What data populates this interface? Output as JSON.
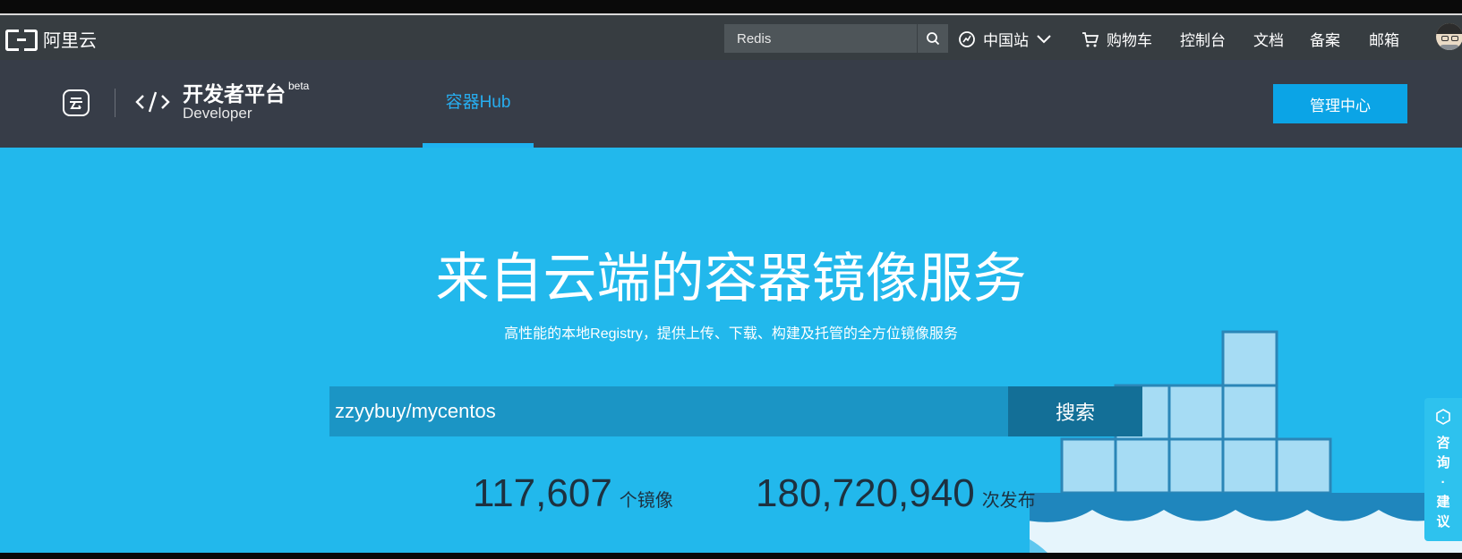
{
  "topbar": {
    "brand": "阿里云",
    "search_value": "Redis",
    "region": "中国站",
    "cart": "购物车",
    "console": "控制台",
    "docs": "文档",
    "beian": "备案",
    "mail": "邮箱"
  },
  "devbar": {
    "title": "开发者平台",
    "subtitle": "Developer",
    "beta": "beta",
    "tab_active": "容器Hub",
    "manage_button": "管理中心"
  },
  "hero": {
    "title": "来自云端的容器镜像服务",
    "subtitle": "高性能的本地Registry，提供上传、下载、构建及托管的全方位镜像服务",
    "search_value": "zzyybuy/mycentos",
    "search_button": "搜索",
    "stats": [
      {
        "number": "117,607",
        "unit": "个镜像"
      },
      {
        "number": "180,720,940",
        "unit": "次发布"
      }
    ]
  },
  "consult": {
    "label": "咨询·建议"
  },
  "colors": {
    "topbar": "#373d41",
    "devbar": "#373d48",
    "hero": "#22b8ec",
    "accent": "#0ba4e6"
  }
}
